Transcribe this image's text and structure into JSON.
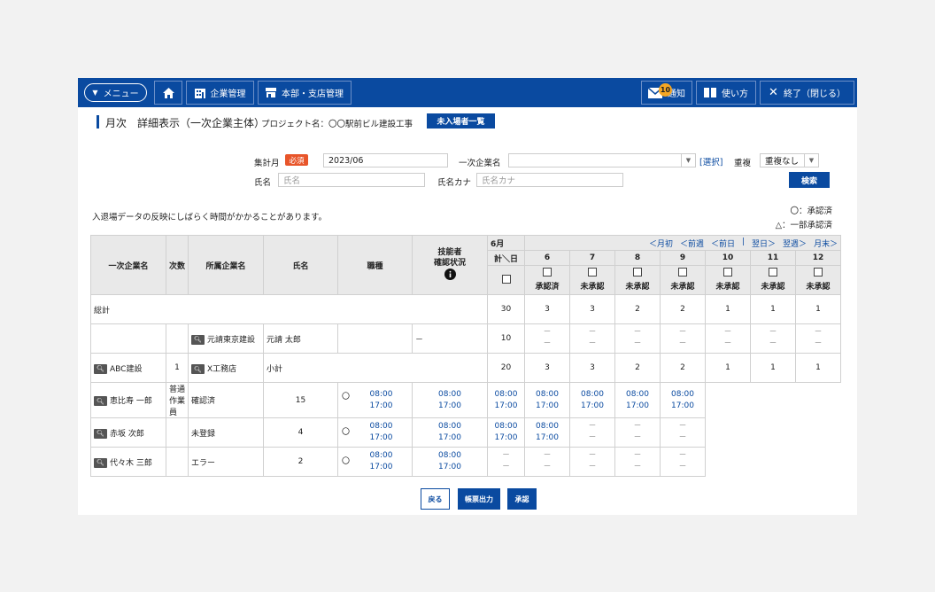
{
  "nav": {
    "menu": "メニュー",
    "company": "企業管理",
    "branch": "本部・支店管理",
    "notice": "通知",
    "notice_count": "10",
    "help": "使い方",
    "exit": "終了（閉じる）"
  },
  "header": {
    "title": "月次　詳細表示（一次企業主体）",
    "project": "プロジェクト名：〇〇駅前ビル建設工事",
    "unentered": "未入場者一覧"
  },
  "filters": {
    "month_label": "集計月",
    "required": "必須",
    "month_value": "2023/06",
    "company_label": "一次企業名",
    "select_link": "[選択]",
    "dup_label": "重複",
    "dup_value": "重複なし",
    "name_label": "氏名",
    "name_ph": "氏名",
    "kana_label": "氏名カナ",
    "kana_ph": "氏名カナ",
    "search_btn": "検索"
  },
  "note": "入退場データの反映にしばらく時間がかかることがあります。",
  "legend": {
    "approved": "〇：承認済",
    "partial": "△：一部承認済"
  },
  "table": {
    "headers": {
      "company": "一次企業名",
      "tier": "次数",
      "affiliate": "所属企業名",
      "name": "氏名",
      "job": "職種",
      "skill": "技能者\n確認状況",
      "month": "6月",
      "total_day": "計＼日"
    },
    "nav_links": [
      "＜月初",
      "＜前週",
      "＜前日",
      "|",
      "翌日＞",
      "翌週＞",
      "月末＞"
    ],
    "days": [
      "6",
      "7",
      "8",
      "9",
      "10",
      "11",
      "12"
    ],
    "day_status": [
      "承認済",
      "未承認",
      "未承認",
      "未承認",
      "未承認",
      "未承認",
      "未承認"
    ],
    "overall": {
      "label": "総計",
      "total": "30",
      "days": [
        "3",
        "3",
        "2",
        "2",
        "1",
        "1",
        "1"
      ]
    },
    "moto": {
      "affiliate": "元請東京建設",
      "name": "元請 太郎",
      "skill": "－",
      "total": "10"
    },
    "abc": {
      "company": "ABC建設",
      "tier": "1",
      "affiliate": "X工務店",
      "subtotal": "小計",
      "total": "20",
      "days": [
        "3",
        "3",
        "2",
        "2",
        "1",
        "1",
        "1"
      ]
    },
    "workers": [
      {
        "name": "恵比寿 一郎",
        "job": "普通作業員",
        "skill": "確認済",
        "total": "15",
        "mark": "〇",
        "days": [
          [
            "08:00",
            "17:00"
          ],
          [
            "08:00",
            "17:00"
          ],
          [
            "08:00",
            "17:00"
          ],
          [
            "08:00",
            "17:00"
          ],
          [
            "08:00",
            "17:00"
          ],
          [
            "08:00",
            "17:00"
          ],
          [
            "08:00",
            "17:00"
          ]
        ]
      },
      {
        "name": "赤坂 次郎",
        "job": "",
        "skill": "未登録",
        "total": "4",
        "mark": "〇",
        "days": [
          [
            "08:00",
            "17:00"
          ],
          [
            "08:00",
            "17:00"
          ],
          [
            "08:00",
            "17:00"
          ],
          [
            "08:00",
            "17:00"
          ],
          [
            "－",
            "－"
          ],
          [
            "－",
            "－"
          ],
          [
            "－",
            "－"
          ]
        ]
      },
      {
        "name": "代々木 三郎",
        "job": "",
        "skill": "エラー",
        "total": "2",
        "mark": "〇",
        "days": [
          [
            "08:00",
            "17:00"
          ],
          [
            "08:00",
            "17:00"
          ],
          [
            "－",
            "－"
          ],
          [
            "－",
            "－"
          ],
          [
            "－",
            "－"
          ],
          [
            "－",
            "－"
          ],
          [
            "－",
            "－"
          ]
        ]
      }
    ]
  },
  "buttons": {
    "back": "戻る",
    "report": "帳票出力",
    "approve": "承認"
  },
  "colors": {
    "primary": "#0a4aa0",
    "required": "#e8552a",
    "badge": "#f5a623"
  }
}
